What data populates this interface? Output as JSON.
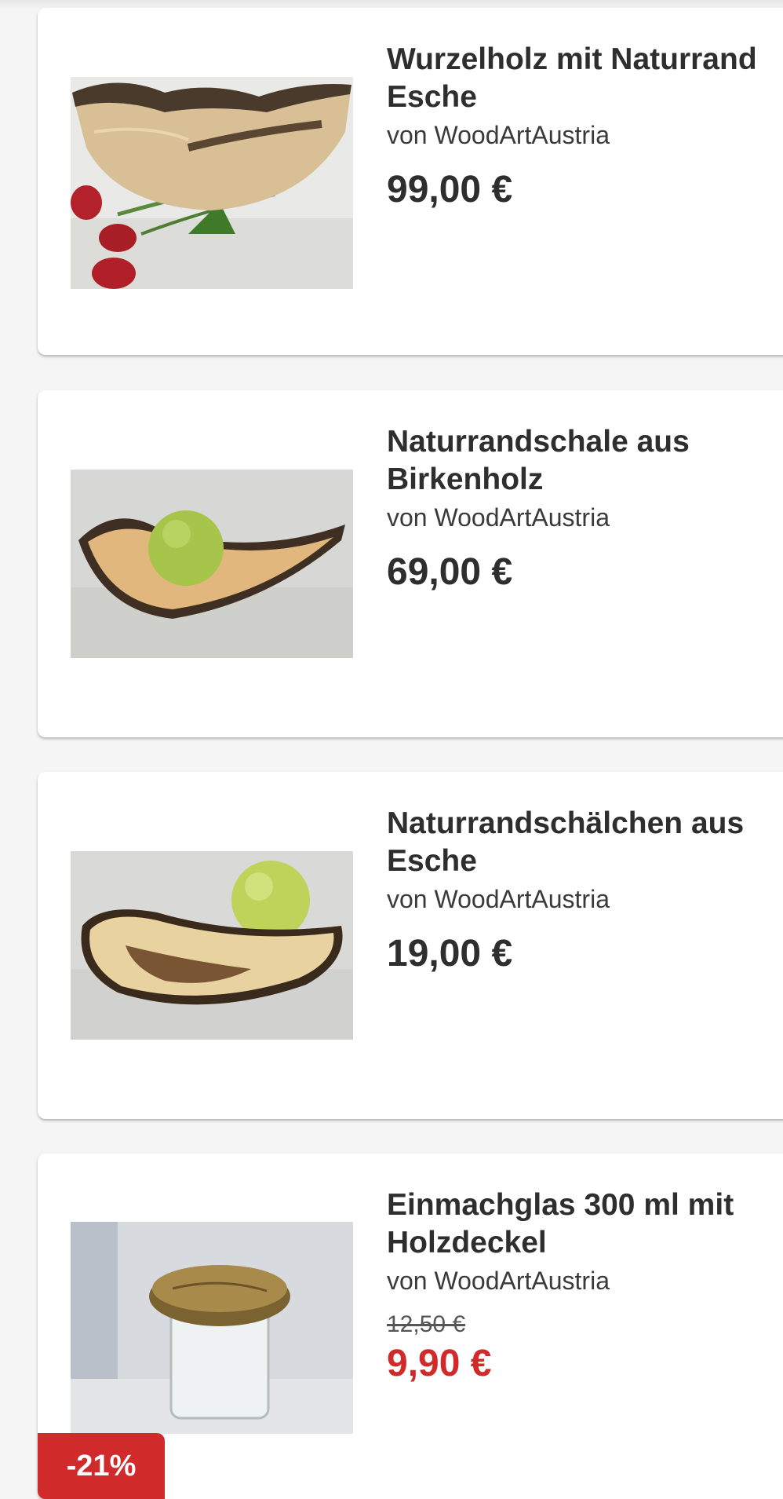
{
  "products": [
    {
      "title": "Wurzelholz mit Naturrand\nEsche",
      "seller": "von WoodArtAustria",
      "price": "99,00 €"
    },
    {
      "title": "Naturrandschale aus\nBirkenholz",
      "seller": "von WoodArtAustria",
      "price": "69,00 €"
    },
    {
      "title": "Naturrandschälchen aus\nEsche",
      "seller": "von WoodArtAustria",
      "price": "19,00 €"
    },
    {
      "title": "Einmachglas 300 ml mit\nHolzdeckel",
      "seller": "von WoodArtAustria",
      "old_price": "12,50 €",
      "sale_price": "9,90 €",
      "discount_badge": "-21%"
    }
  ],
  "colors": {
    "sale": "#d02a2a",
    "text": "#2e2e2e",
    "card": "#ffffff",
    "background": "#f5f5f5"
  }
}
